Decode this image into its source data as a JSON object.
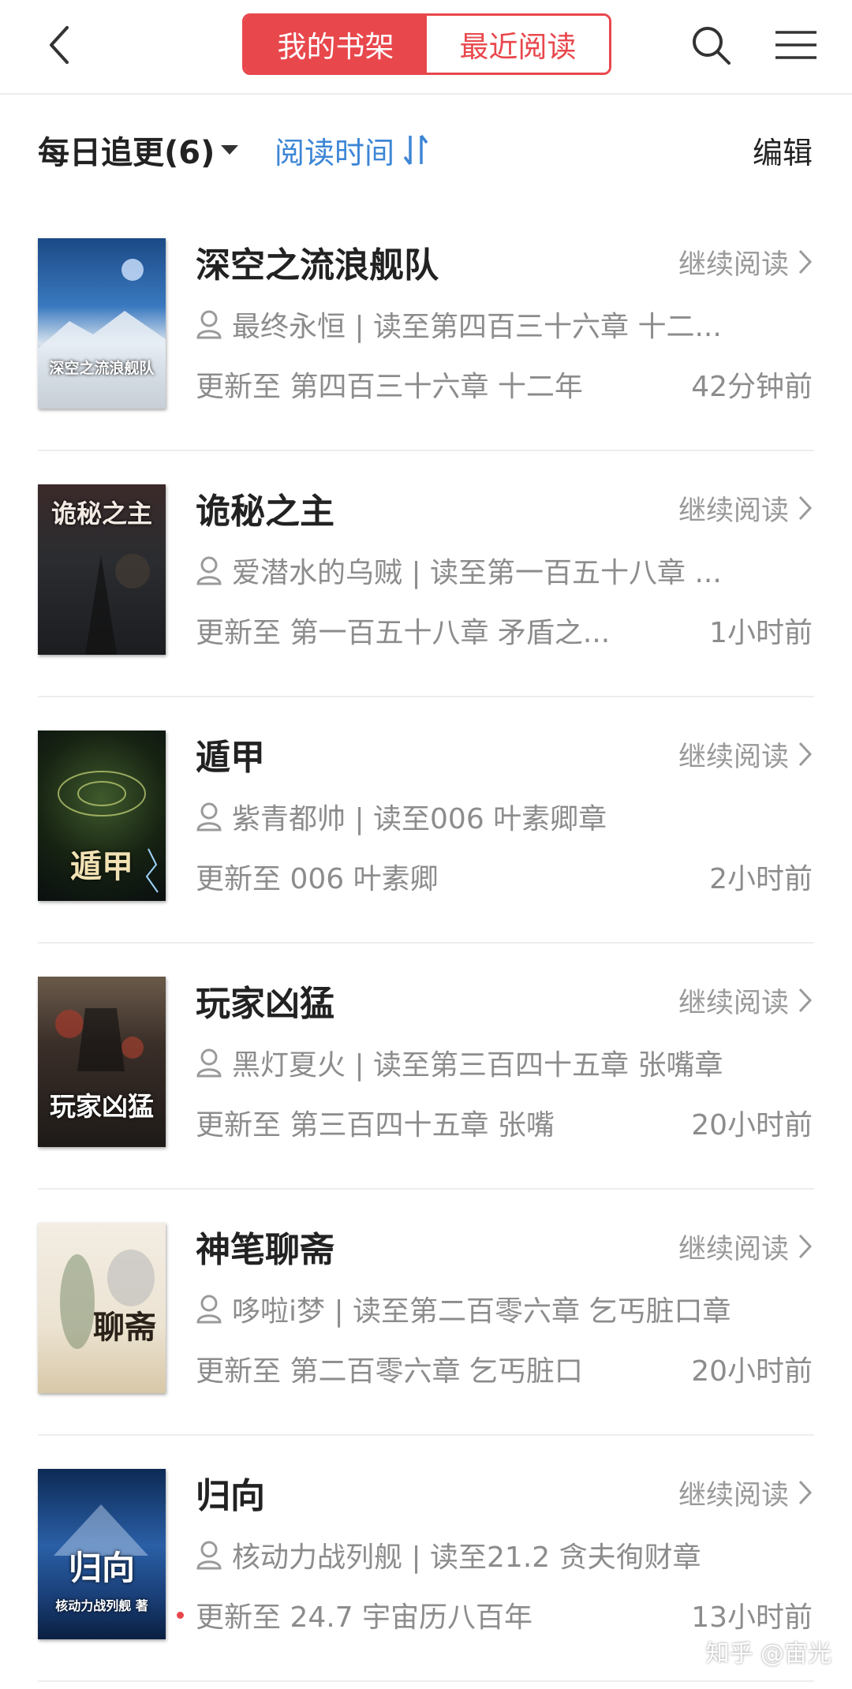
{
  "header": {
    "tabs": [
      "我的书架",
      "最近阅读"
    ],
    "icons": {
      "back": "chevron-left-icon",
      "search": "search-icon",
      "menu": "hamburger-menu-icon"
    }
  },
  "filter": {
    "group_label": "每日追更(6)",
    "sort_label": "阅读时间",
    "edit_label": "编辑"
  },
  "continue_label": "继续阅读",
  "accent_color": "#e8474c",
  "link_color": "#3d86d6",
  "books": [
    {
      "title": "深空之流浪舰队",
      "cover_text": "深空之流浪舰队",
      "author_progress": "最终永恒 | 读至第四百三十六章 十二...",
      "update": "更新至 第四百三十六章 十二年",
      "time": "42分钟前"
    },
    {
      "title": "诡秘之主",
      "cover_text": "诡秘之主",
      "author_progress": "爱潜水的乌贼 | 读至第一百五十八章 ...",
      "update": "更新至 第一百五十八章 矛盾之...",
      "time": "1小时前"
    },
    {
      "title": "遁甲",
      "cover_text": "遁甲",
      "author_progress": "紫青都帅 | 读至006 叶素卿章",
      "update": "更新至 006 叶素卿",
      "time": "2小时前"
    },
    {
      "title": "玩家凶猛",
      "cover_text": "玩家凶猛",
      "author_progress": "黑灯夏火 | 读至第三百四十五章 张嘴章",
      "update": "更新至 第三百四十五章 张嘴",
      "time": "20小时前"
    },
    {
      "title": "神笔聊斋",
      "cover_text": "聊斋",
      "author_progress": "哆啦i梦 | 读至第二百零六章 乞丐脏口章",
      "update": "更新至 第二百零六章 乞丐脏口",
      "time": "20小时前"
    },
    {
      "title": "归向",
      "cover_text": "归向",
      "cover_subtext": "核动力战列舰 著",
      "author_progress": "核动力战列舰 | 读至21.2 贪夫徇财章",
      "update": "更新至 24.7 宇宙历八百年",
      "time": "13小时前",
      "has_new_dot": true
    }
  ],
  "watermark": "知乎 @宙光"
}
